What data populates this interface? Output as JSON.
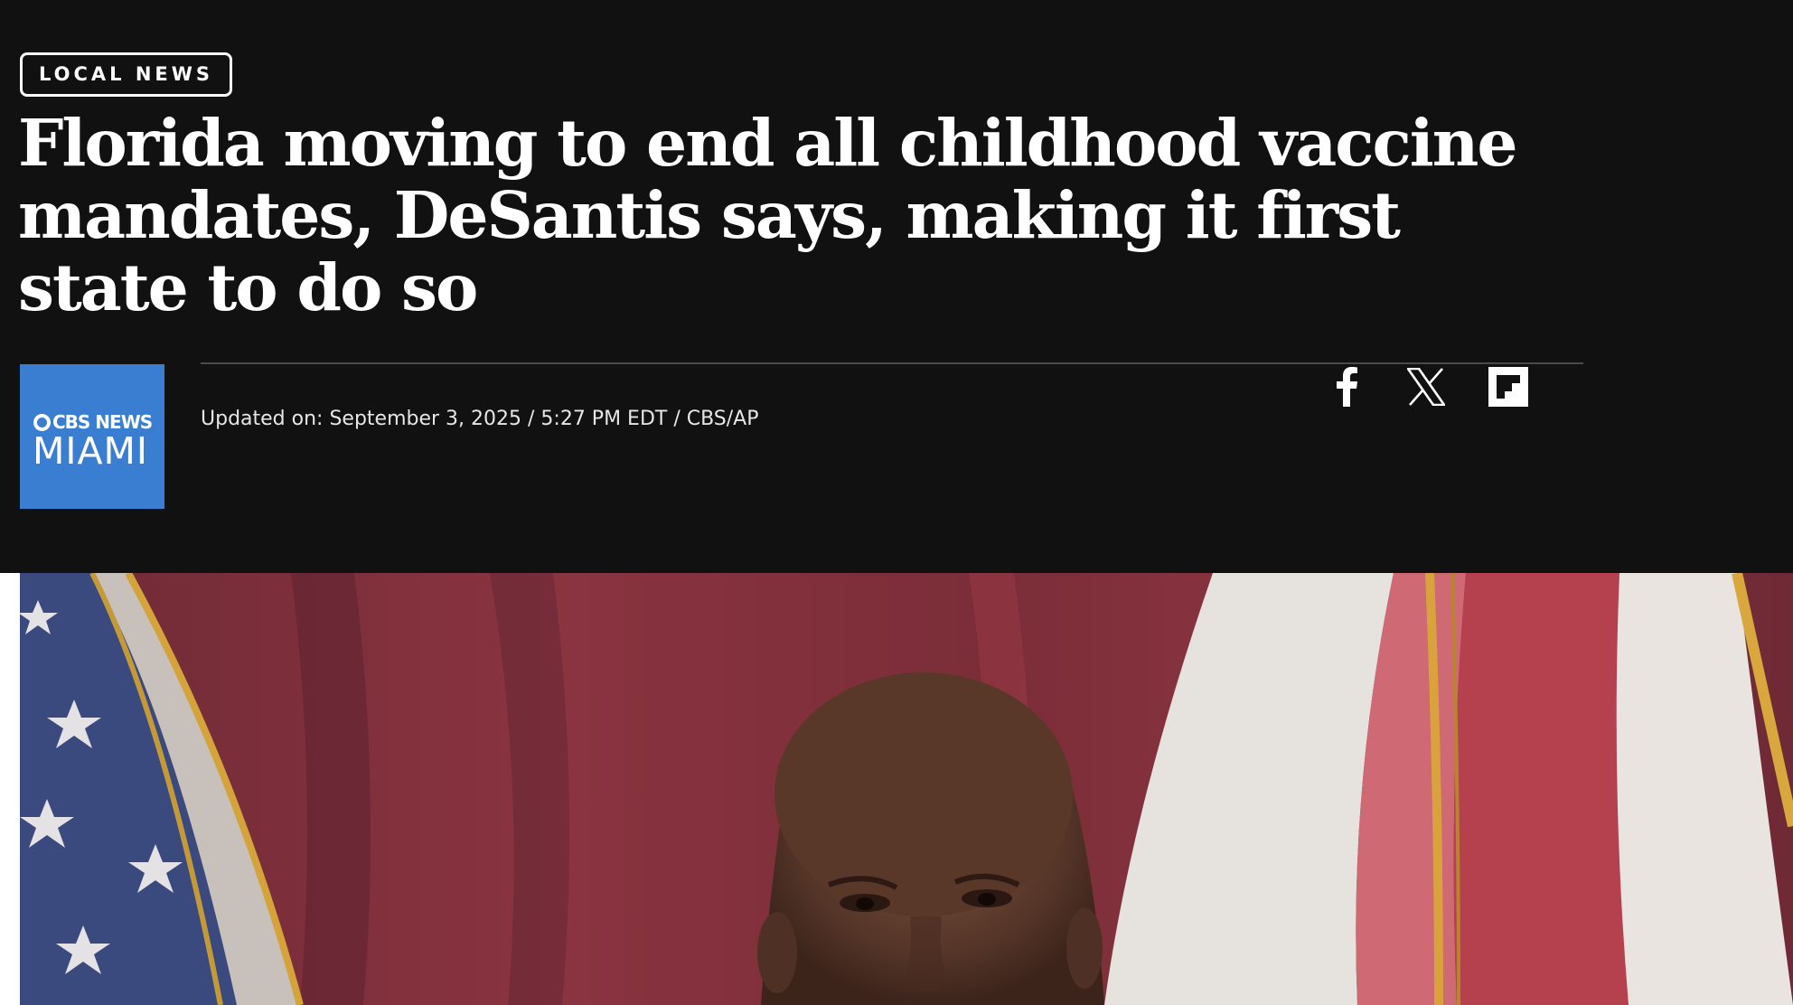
{
  "article": {
    "section_label": "LOCAL NEWS",
    "headline": "Florida moving to end all childhood vaccine mandates, DeSantis says, making it first state to do so",
    "updated_line": "Updated on: September 3, 2025 / 5:27 PM EDT / CBS/AP"
  },
  "logo": {
    "top_text": "CBS NEWS",
    "bottom_text": "MIAMI",
    "icon": "cbs-eye-icon"
  },
  "share": {
    "icons": [
      "facebook-icon",
      "x-icon",
      "flipboard-icon"
    ]
  },
  "colors": {
    "header_background": "#111111",
    "text": "#ffffff",
    "logo_background": "#3a7ed2"
  },
  "media": {
    "image_subject": "man speaking in front of flags"
  }
}
